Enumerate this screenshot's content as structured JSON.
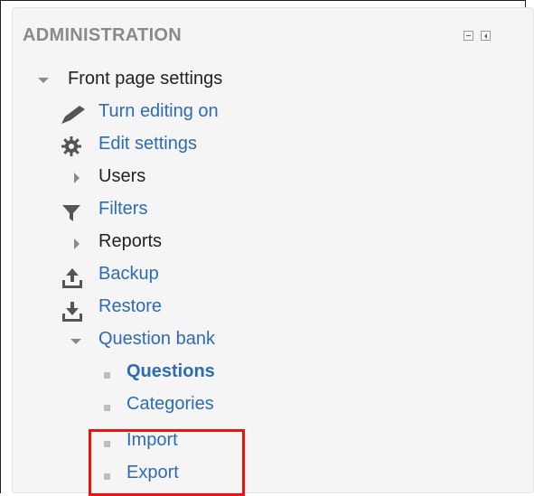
{
  "block": {
    "title": "ADMINISTRATION",
    "controls": {
      "minimize_icon": "minimize-icon",
      "dock_icon": "dock-icon"
    }
  },
  "nav": {
    "front_page": "Front page settings",
    "turn_editing": "Turn editing on",
    "edit_settings": "Edit settings",
    "users": "Users",
    "filters": "Filters",
    "reports": "Reports",
    "backup": "Backup",
    "restore": "Restore",
    "question_bank": "Question bank",
    "questions": "Questions",
    "categories": "Categories",
    "import": "Import",
    "export": "Export"
  },
  "colors": {
    "link": "#2b6cb5",
    "text": "#222222",
    "title": "#8a8a8a",
    "highlight": "#ee1111",
    "icon": "#555555",
    "bullet": "#bdbdbd"
  }
}
